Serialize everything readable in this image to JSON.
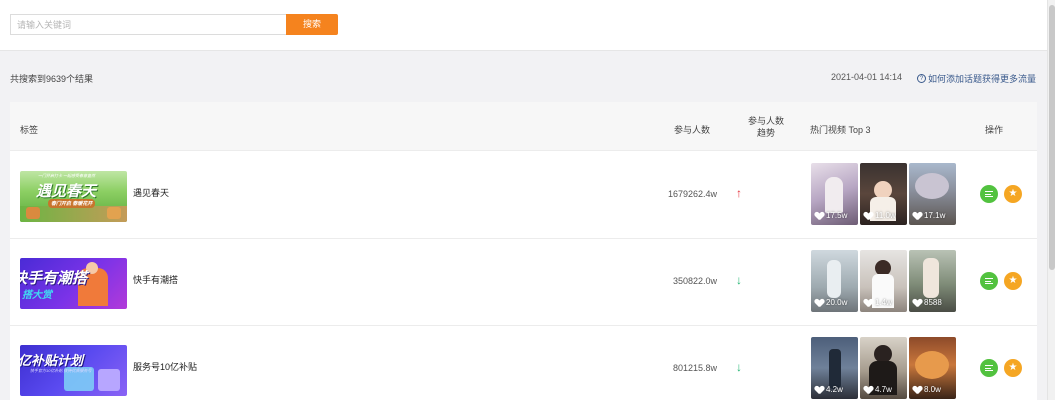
{
  "search": {
    "placeholder": "请输入关键词",
    "value": "",
    "button_label": "搜索"
  },
  "summary": "共搜索到9639个结果",
  "timestamp": "2021-04-01 14:14",
  "help_link": "如何添加话题获得更多流量",
  "table": {
    "headers": {
      "tag": "标签",
      "count": "参与人数",
      "trend_line1": "参与人数",
      "trend_line2": "趋势",
      "hot": "热门视频 Top 3",
      "op": "操作"
    },
    "rows": [
      {
        "name": "遇见春天",
        "banner_text": "遇见春天",
        "banner_sub": "一门开启打卡 一起感受春意盎然",
        "banner_sub2": "春门开启 春暖花开",
        "count": "1679262.4w",
        "trend": "up",
        "trend_symbol": "↑",
        "videos": [
          {
            "likes": "17.5w"
          },
          {
            "likes": "11.0w"
          },
          {
            "likes": "17.1w"
          }
        ]
      },
      {
        "name": "快手有潮搭",
        "banner_text": "快手有潮搭",
        "banner_sub": "搭大赏",
        "count": "350822.0w",
        "trend": "down",
        "trend_symbol": "↓",
        "videos": [
          {
            "likes": "20.0w"
          },
          {
            "likes": "1.4w"
          },
          {
            "likes": "8588"
          }
        ]
      },
      {
        "name": "服务号10亿补贴",
        "banner_text": "亿补贴计划",
        "banner_sub": "快手官方10亿补贴 扶持优质服务号",
        "count": "801215.8w",
        "trend": "down",
        "trend_symbol": "↓",
        "videos": [
          {
            "likes": "4.2w"
          },
          {
            "likes": "4.7w"
          },
          {
            "likes": "8.0w"
          }
        ]
      }
    ]
  },
  "colors": {
    "accent": "#f5831e",
    "trend_up": "#e5323b",
    "trend_down": "#22b573",
    "op_list": "#52c23f",
    "op_star": "#f5a623",
    "link": "#3a5a8c"
  },
  "icons": {
    "op_list": "list-icon",
    "op_star": "star-icon",
    "like": "heart-icon",
    "help": "question-circle-icon"
  }
}
